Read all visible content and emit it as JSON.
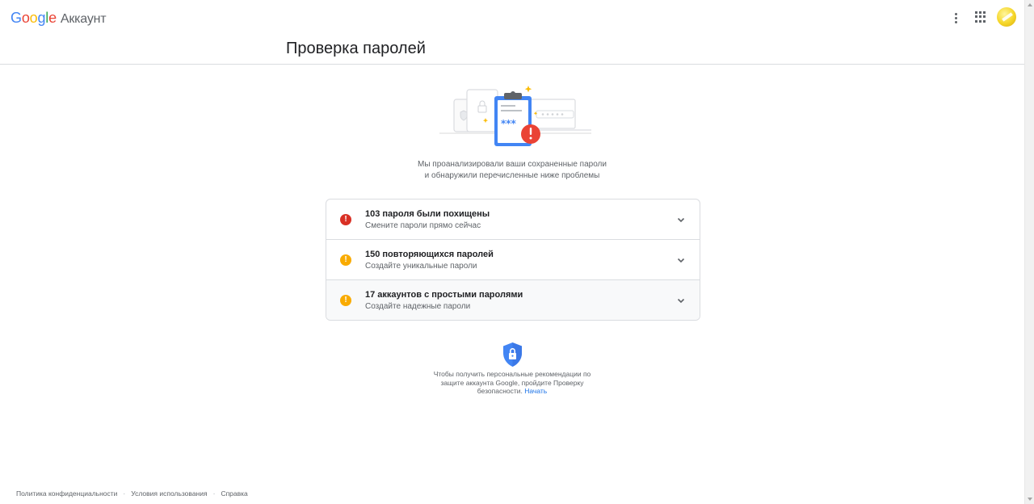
{
  "header": {
    "logo_google": [
      "G",
      "o",
      "o",
      "g",
      "l",
      "e"
    ],
    "product_name": "Аккаунт",
    "more_icon": "more-vert-icon",
    "apps_icon": "apps-grid-icon",
    "avatar_color": "#f5d627"
  },
  "page": {
    "title": "Проверка паролей"
  },
  "intro": {
    "line1": "Мы проанализировали ваши сохраненные пароли",
    "line2": "и обнаружили перечисленные ниже проблемы"
  },
  "issues": [
    {
      "title": "103 пароля были похищены",
      "subtitle": "Смените пароли прямо сейчас",
      "severity": "red",
      "severity_color": "#d93025",
      "icon": "error-icon"
    },
    {
      "title": "150 повторяющихся паролей",
      "subtitle": "Создайте уникальные пароли",
      "severity": "yellow",
      "severity_color": "#f9ab00",
      "icon": "warning-icon"
    },
    {
      "title": "17 аккаунтов с простыми паролями",
      "subtitle": "Создайте надежные пароли",
      "severity": "yellow",
      "severity_color": "#f9ab00",
      "icon": "warning-icon"
    }
  ],
  "checkup": {
    "text_line1": "Чтобы получить персональные рекомендации по",
    "text_line2": "защите аккаунта Google, пройдите Проверку",
    "text_line3": "безопасности.",
    "link": "Начать"
  },
  "footer": {
    "privacy": "Политика конфиденциальности",
    "separator": "·",
    "terms": "Условия использования",
    "help": "Справка"
  },
  "colors": {
    "accent": "#1a73e8",
    "divider": "#dadce0"
  }
}
